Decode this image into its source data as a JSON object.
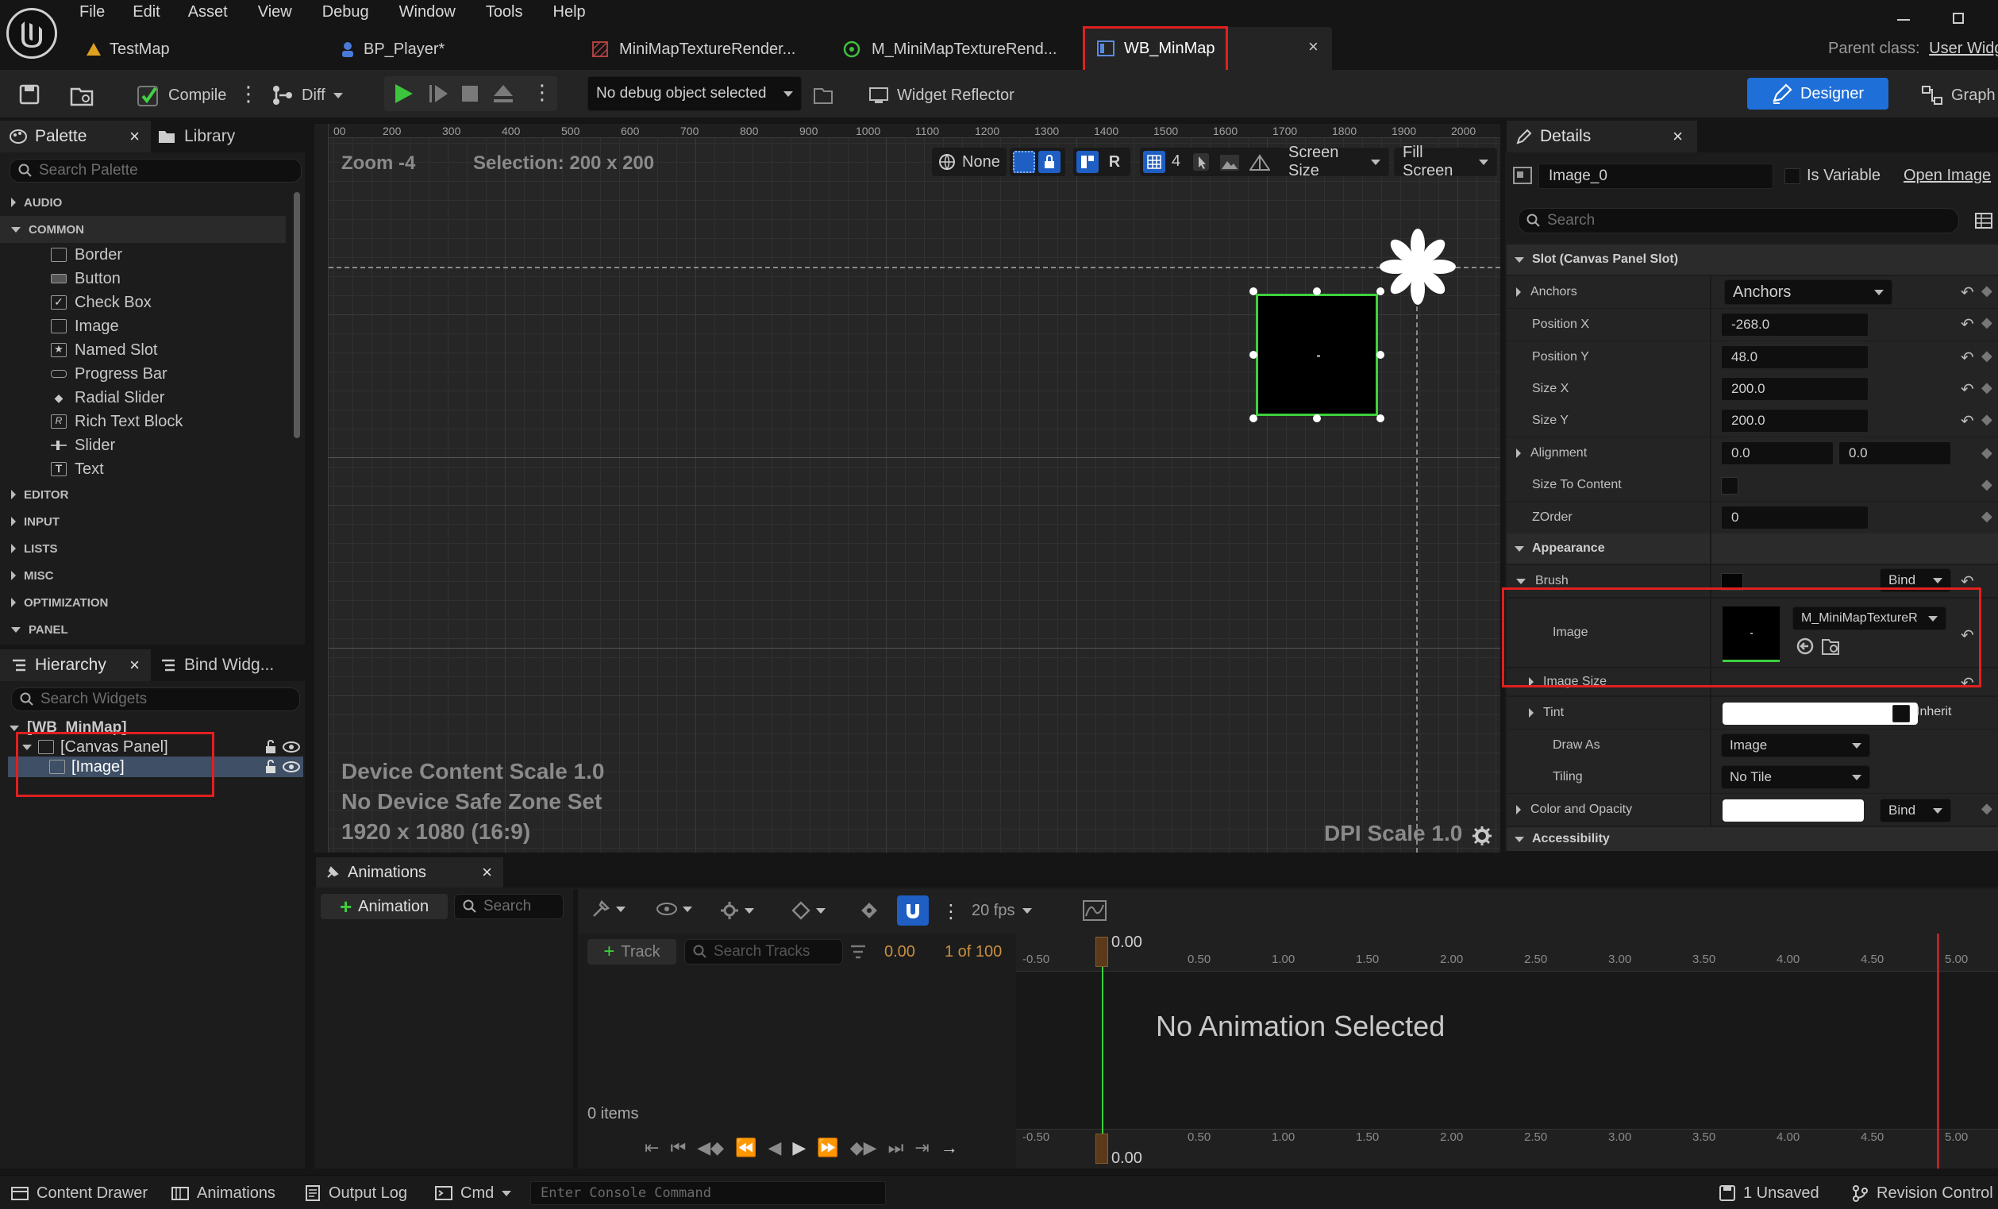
{
  "menu": {
    "items": [
      "File",
      "Edit",
      "Asset",
      "View",
      "Debug",
      "Window",
      "Tools",
      "Help"
    ]
  },
  "tabs": [
    {
      "label": "TestMap",
      "icon": "level-icon"
    },
    {
      "label": "BP_Player*",
      "icon": "blueprint-icon"
    },
    {
      "label": "MiniMapTextureRender...",
      "icon": "texture-icon"
    },
    {
      "label": "M_MiniMapTextureRend...",
      "icon": "material-icon"
    },
    {
      "label": "WB_MinMap",
      "icon": "widget-blueprint-icon"
    }
  ],
  "parent_class": {
    "label": "Parent class:",
    "value": "User Widg"
  },
  "toolbar": {
    "compile": "Compile",
    "diff": "Diff",
    "debug_object": "No debug object selected",
    "widget_reflector": "Widget Reflector",
    "designer": "Designer",
    "graph": "Graph"
  },
  "palette": {
    "tab": "Palette",
    "library_tab": "Library",
    "search_placeholder": "Search Palette",
    "categories": [
      "AUDIO",
      "COMMON",
      "EDITOR",
      "INPUT",
      "LISTS",
      "MISC",
      "OPTIMIZATION",
      "PANEL"
    ],
    "common_items": [
      "Border",
      "Button",
      "Check Box",
      "Image",
      "Named Slot",
      "Progress Bar",
      "Radial Slider",
      "Rich Text Block",
      "Slider",
      "Text"
    ]
  },
  "hierarchy": {
    "tab": "Hierarchy",
    "bind_tab": "Bind Widg...",
    "search_placeholder": "Search Widgets",
    "root": "[WB_MinMap]",
    "canvas": "[Canvas Panel]",
    "image": "[Image]"
  },
  "viewport": {
    "zoom": "Zoom -4",
    "selection": "Selection: 200 x 200",
    "none_label": "None",
    "r_label": "R",
    "grid_value": "4",
    "screen_size": "Screen Size",
    "fill_screen": "Fill Screen",
    "ruler_h": [
      "00",
      "200",
      "300",
      "400",
      "500",
      "600",
      "700",
      "800",
      "900",
      "1000",
      "1100",
      "1200",
      "1300",
      "1400",
      "1500",
      "1600",
      "1700",
      "1800",
      "1900",
      "2000"
    ],
    "device_scale": "Device Content Scale 1.0",
    "safe_zone": "No Device Safe Zone Set",
    "resolution": "1920 x 1080 (16:9)",
    "dpi": "DPI Scale 1.0"
  },
  "details": {
    "tab": "Details",
    "name_value": "Image_0",
    "is_variable": "Is Variable",
    "open_image": "Open Image",
    "search_placeholder": "Search",
    "slot_section": "Slot (Canvas Panel Slot)",
    "anchors_label": "Anchors",
    "anchors_value": "Anchors",
    "pos_x_label": "Position X",
    "pos_x": "-268.0",
    "pos_y_label": "Position Y",
    "pos_y": "48.0",
    "size_x_label": "Size X",
    "size_x": "200.0",
    "size_y_label": "Size Y",
    "size_y": "200.0",
    "alignment_label": "Alignment",
    "align_x": "0.0",
    "align_y": "0.0",
    "size_to_content_label": "Size To Content",
    "zorder_label": "ZOrder",
    "zorder": "0",
    "appearance_section": "Appearance",
    "brush_label": "Brush",
    "bind": "Bind",
    "image_label": "Image",
    "image_asset": "M_MiniMapTextureR",
    "image_size_label": "Image Size",
    "tint_label": "Tint",
    "inherit": "Inherit",
    "draw_as_label": "Draw As",
    "draw_as": "Image",
    "tiling_label": "Tiling",
    "tiling": "No Tile",
    "color_opacity_label": "Color and Opacity",
    "accessibility_section": "Accessibility"
  },
  "animations": {
    "tab": "Animations",
    "add_button": "Animation",
    "search_placeholder": "Search",
    "track_button": "Track",
    "search_tracks_placeholder": "Search Tracks",
    "time": "0.00",
    "frame": "1 of 100",
    "fps": "20 fps",
    "items": "0 items",
    "no_animation": "No Animation Selected",
    "timeline_ticks": [
      "-0.50",
      "0.50",
      "1.00",
      "1.50",
      "2.00",
      "2.50",
      "3.00",
      "3.50",
      "4.00",
      "4.50",
      "5.00"
    ],
    "playhead": "0.00"
  },
  "statusbar": {
    "content_drawer": "Content Drawer",
    "animations": "Animations",
    "output_log": "Output Log",
    "cmd": "Cmd",
    "console_placeholder": "Enter Console Command",
    "unsaved": "1 Unsaved",
    "revision_control": "Revision Control"
  },
  "colors": {
    "accent_blue": "#1f6fd8",
    "highlight_red": "#e02020",
    "selection_green": "#3dd13d",
    "bg_dark": "#151515",
    "panel": "#242424"
  }
}
